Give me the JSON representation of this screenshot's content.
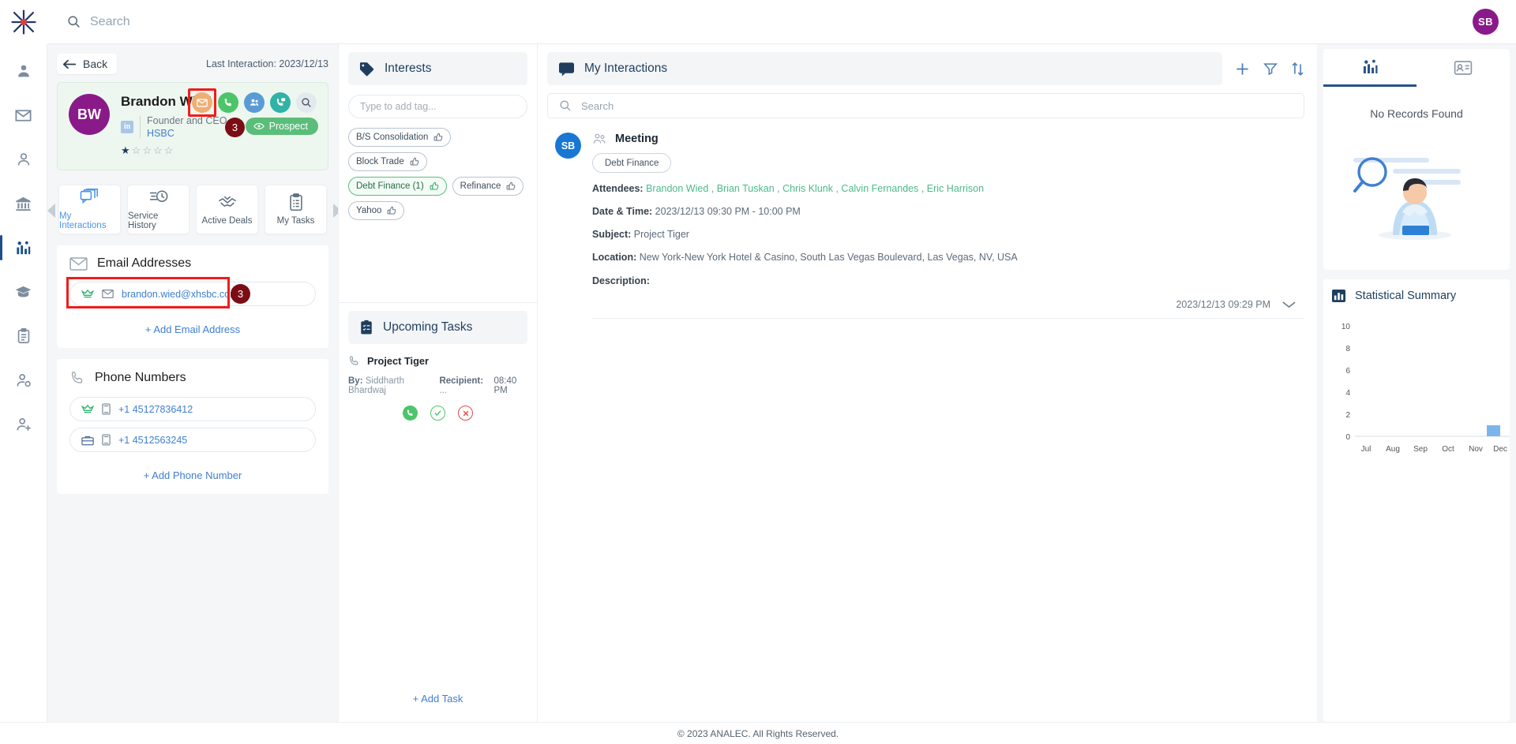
{
  "topbar": {
    "search_placeholder": "Search",
    "user_initials": "SB",
    "logo_name": "analec-logo"
  },
  "rail": {
    "items": [
      {
        "name": "contacts-nav",
        "icon": "person-icon"
      },
      {
        "name": "email-nav",
        "icon": "envelope-icon"
      },
      {
        "name": "profile-nav",
        "icon": "user-icon"
      },
      {
        "name": "institution-nav",
        "icon": "bank-icon"
      },
      {
        "name": "analytics-nav",
        "icon": "chart-people-icon",
        "active": true
      },
      {
        "name": "graduation-nav",
        "icon": "cap-icon"
      },
      {
        "name": "tasks-nav",
        "icon": "clipboard-icon"
      },
      {
        "name": "user-group-nav",
        "icon": "user-settings-icon"
      },
      {
        "name": "user-add-nav",
        "icon": "user-add-icon"
      }
    ]
  },
  "contact": {
    "back_label": "Back",
    "last_interaction": "Last Interaction: 2023/12/13",
    "initials": "BW",
    "name": "Brandon Wied",
    "role": "Founder and CEO",
    "organization": "HSBC",
    "linkedin_label": "in",
    "rating": 1,
    "rating_max": 5,
    "status_label": "Prospect",
    "mail_badge_count": "3",
    "actions": [
      {
        "name": "email-action",
        "icon": "envelope-icon",
        "color": "#efae73",
        "highlighted": true
      },
      {
        "name": "call-action",
        "icon": "phone-icon",
        "color": "#4cc56a"
      },
      {
        "name": "meeting-action",
        "icon": "people-icon",
        "color": "#5a9bd5"
      },
      {
        "name": "call-log-action",
        "icon": "phone-chat-icon",
        "color": "#2fb3a6"
      },
      {
        "name": "search-action",
        "icon": "search-icon",
        "color": "#e4e9ee"
      }
    ],
    "tabs": [
      {
        "label": "My Interactions",
        "icon": "chat-stack-icon",
        "active": true
      },
      {
        "label": "Service History",
        "icon": "history-clock-icon",
        "active": false
      },
      {
        "label": "Active Deals",
        "icon": "handshake-check-icon",
        "active": false
      },
      {
        "label": "My Tasks",
        "icon": "clipboard-list-icon",
        "active": false
      }
    ],
    "email_section": {
      "title": "Email Addresses",
      "icon": "envelope-icon",
      "rows": [
        {
          "value": "brandon.wied@xhsbc.com",
          "type_icon": "crown-icon",
          "kind_icon": "envelope-icon",
          "badge": "3",
          "highlighted": true
        }
      ],
      "add_label": "+ Add Email Address"
    },
    "phone_section": {
      "title": "Phone Numbers",
      "icon": "phone-icon",
      "rows": [
        {
          "value": "+1 45127836412",
          "type_icon": "crown-icon",
          "kind_icon": "mobile-icon"
        },
        {
          "value": "+1 4512563245",
          "type_icon": "briefcase-icon",
          "kind_icon": "mobile-icon"
        }
      ],
      "add_label": "+ Add Phone Number"
    }
  },
  "interests": {
    "title": "Interests",
    "icon": "tag-icon",
    "tag_input_placeholder": "Type to add tag...",
    "tags": [
      {
        "label": "B/S Consolidation",
        "selected": false
      },
      {
        "label": "Block Trade",
        "selected": false
      },
      {
        "label": "Debt Finance (1)",
        "selected": true
      },
      {
        "label": "Refinance",
        "selected": false
      },
      {
        "label": "Yahoo",
        "selected": false
      }
    ]
  },
  "upcoming_tasks": {
    "title": "Upcoming Tasks",
    "icon": "clipboard-check-icon",
    "task": {
      "name": "Project Tiger",
      "icon": "phone-icon",
      "by_label": "By:",
      "by_value": "Siddharth Bhardwaj",
      "recipient_label": "Recipient:",
      "recipient_value": "...",
      "time": "08:40 PM"
    },
    "add_label": "+ Add Task"
  },
  "interactions": {
    "title": "My Interactions",
    "icon": "chat-icon",
    "tools": [
      {
        "name": "add-interaction-button",
        "icon": "plus-icon"
      },
      {
        "name": "filter-button",
        "icon": "filter-icon"
      },
      {
        "name": "sort-button",
        "icon": "sort-icon"
      }
    ],
    "search_placeholder": "Search",
    "items": [
      {
        "avatar": "SB",
        "type": "Meeting",
        "type_icon": "meeting-people-icon",
        "tag": "Debt Finance",
        "attendees_label": "Attendees:",
        "attendees": "Brandon Wied , Brian Tuskan , Chris Klunk , Calvin Fernandes , Eric Harrison",
        "datetime_label": "Date & Time:",
        "datetime": "2023/12/13 09:30 PM - 10:00 PM",
        "subject_label": "Subject:",
        "subject": "Project Tiger",
        "location_label": "Location:",
        "location": "New York-New York Hotel & Casino, South Las Vegas Boulevard, Las Vegas, NV, USA",
        "description_label": "Description:",
        "description": "",
        "timestamp": "2023/12/13 09:29 PM"
      }
    ]
  },
  "right_panel": {
    "tabs": [
      {
        "name": "analytics-tab",
        "icon": "chart-people-icon",
        "active": true
      },
      {
        "name": "contacts-tab",
        "icon": "contact-card-icon",
        "active": false
      }
    ],
    "empty_text": "No Records Found",
    "stat_title": "Statistical Summary",
    "stat_icon": "bar-chart-icon",
    "chart_data": {
      "type": "bar",
      "title": "Statistical Summary",
      "categories": [
        "Jul",
        "Aug",
        "Sep",
        "Oct",
        "Nov",
        "Dec"
      ],
      "values": [
        0,
        0,
        0,
        0,
        0,
        1
      ],
      "yticks": [
        0,
        2,
        4,
        6,
        8,
        10
      ],
      "ylim": [
        0,
        10
      ],
      "xlabel": "",
      "ylabel": "",
      "grid": false,
      "bar_color": "#7cb5ec",
      "legend": "none"
    }
  },
  "footer": {
    "copyright": "© 2023 ANALEC. All Rights Reserved."
  }
}
